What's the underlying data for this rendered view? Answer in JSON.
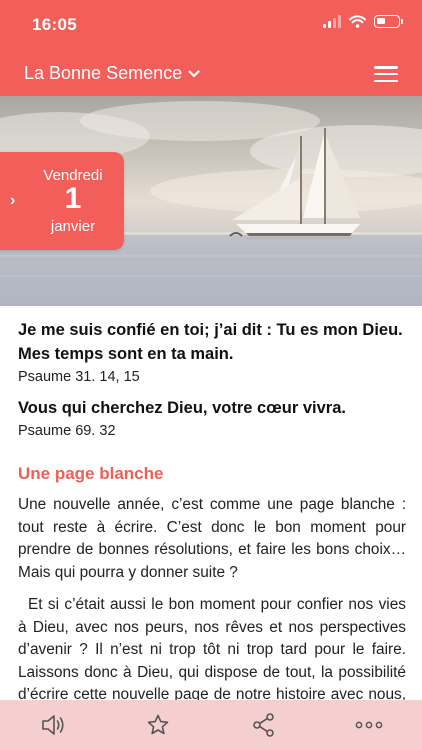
{
  "status_bar": {
    "time": "16:05"
  },
  "nav": {
    "title": "La Bonne Semence",
    "title_icon": "chevron-down-icon",
    "menu_icon": "hamburger-menu-icon"
  },
  "date": {
    "weekday": "Vendredi",
    "day": "1",
    "month": "janvier"
  },
  "verses": [
    {
      "text": "Je me suis confié en toi; j’ai dit : Tu es mon Dieu. Mes temps sont en ta main.",
      "ref": "Psaume 31. 14, 15"
    },
    {
      "text": "Vous qui cherchez Dieu, votre cœur vivra.",
      "ref": "Psaume 69. 32"
    }
  ],
  "article": {
    "title": "Une page blanche",
    "paragraphs": [
      "Une nouvelle année, c’est comme une page blanche : tout reste à écrire. C’est donc le bon moment pour prendre de bonnes résolutions, et faire les bons choix… Mais qui pourra y donner suite ?",
      "Et si c’était aussi le bon moment pour confier nos vies à Dieu, avec nos peurs, nos rêves et nos perspectives d’avenir ? Il n’est ni trop tôt ni trop tard pour le faire. Laissons donc à Dieu, qui dispose de tout, la possibilité d’écrire cette nouvelle page de notre histoire avec nous, en étant bien conscients que son regard ne peut être le"
    ]
  },
  "bottom_bar": [
    "audio-icon",
    "star-icon",
    "share-icon",
    "more-icon"
  ],
  "colors": {
    "accent": "#f25f5a",
    "bottom_bar": "#f5cfcf",
    "section_title": "#ee5f55"
  }
}
